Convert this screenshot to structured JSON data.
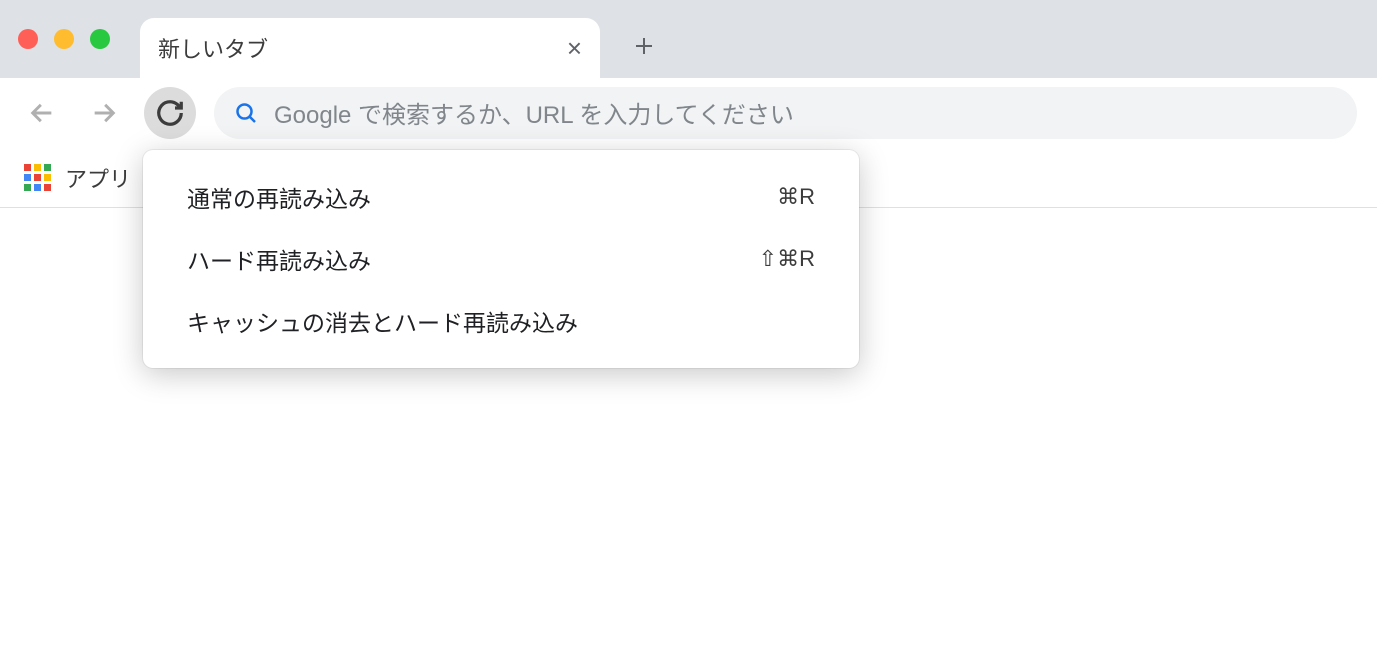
{
  "tab": {
    "title": "新しいタブ"
  },
  "omnibox": {
    "placeholder": "Google で検索するか、URL を入力してください"
  },
  "bookmarks": {
    "apps_label": "アプリ"
  },
  "context_menu": {
    "items": [
      {
        "label": "通常の再読み込み",
        "shortcut": "⌘R"
      },
      {
        "label": "ハード再読み込み",
        "shortcut": "⇧⌘R"
      },
      {
        "label": "キャッシュの消去とハード再読み込み",
        "shortcut": ""
      }
    ]
  },
  "apps_icon_colors": [
    "#ea4335",
    "#fbbc04",
    "#34a853",
    "#4285f4",
    "#ea4335",
    "#fbbc04",
    "#34a853",
    "#4285f4",
    "#ea4335"
  ]
}
